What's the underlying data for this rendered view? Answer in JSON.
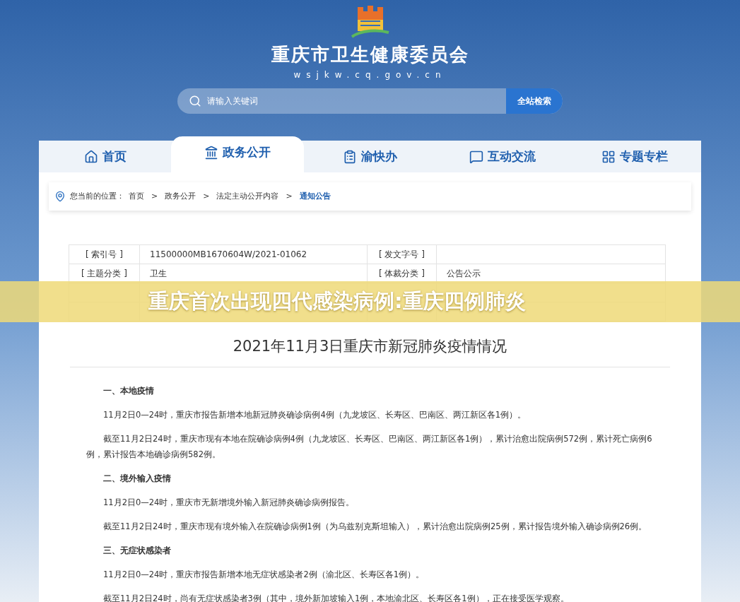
{
  "site": {
    "title": "重庆市卫生健康委员会",
    "domain": "wsjkw.cq.gov.cn"
  },
  "search": {
    "placeholder": "请输入关键词",
    "button": "全站检索"
  },
  "nav": [
    {
      "label": "首页",
      "selected": false
    },
    {
      "label": "政务公开",
      "selected": true
    },
    {
      "label": "渝快办",
      "selected": false
    },
    {
      "label": "互动交流",
      "selected": false
    },
    {
      "label": "专题专栏",
      "selected": false
    }
  ],
  "breadcrumb": {
    "label": "您当前的位置：",
    "separator": ">",
    "items": [
      "首页",
      "政务公开",
      "法定主动公开内容",
      "通知公告"
    ]
  },
  "info_table": [
    {
      "label_1": "[ 索引号 ]",
      "value_1": "11500000MB1670604W/2021-01062",
      "label_2": "[ 发文字号 ]"
    },
    {
      "label_1": "[ 主题分类 ]",
      "value_1": "卫生",
      "label_2": "[ 体裁分类 ]",
      "value_2": "公告公示"
    }
  ],
  "overlay_banner": "重庆首次出现四代感染病例:重庆四例肺炎",
  "article": {
    "title": "2021年11月3日重庆市新冠肺炎疫情情况",
    "blocks": [
      {
        "kind": "heading",
        "text": "一、本地疫情"
      },
      {
        "kind": "paragraph",
        "text": "11月2日0—24时，重庆市报告新增本地新冠肺炎确诊病例4例（九龙坡区、长寿区、巴南区、两江新区各1例）。"
      },
      {
        "kind": "paragraph",
        "text": "截至11月2日24时，重庆市现有本地在院确诊病例4例（九龙坡区、长寿区、巴南区、两江新区各1例），累计治愈出院病例572例，累计死亡病例6例，累计报告本地确诊病例582例。"
      },
      {
        "kind": "heading",
        "text": "二、境外输入疫情"
      },
      {
        "kind": "paragraph",
        "text": "11月2日0—24时，重庆市无新增境外输入新冠肺炎确诊病例报告。"
      },
      {
        "kind": "paragraph",
        "text": "截至11月2日24时，重庆市现有境外输入在院确诊病例1例（为乌兹别克斯坦输入），累计治愈出院病例25例，累计报告境外输入确诊病例26例。"
      },
      {
        "kind": "heading",
        "text": "三、无症状感染者"
      },
      {
        "kind": "paragraph",
        "text": "11月2日0—24时，重庆市报告新增本地无症状感染者2例（渝北区、长寿区各1例）。"
      },
      {
        "kind": "paragraph",
        "text": "截至11月2日24时，尚有无症状感染者3例（其中，境外新加坡输入1例，本地渝北区、长寿区各1例），正在接受医学观察。"
      }
    ]
  }
}
